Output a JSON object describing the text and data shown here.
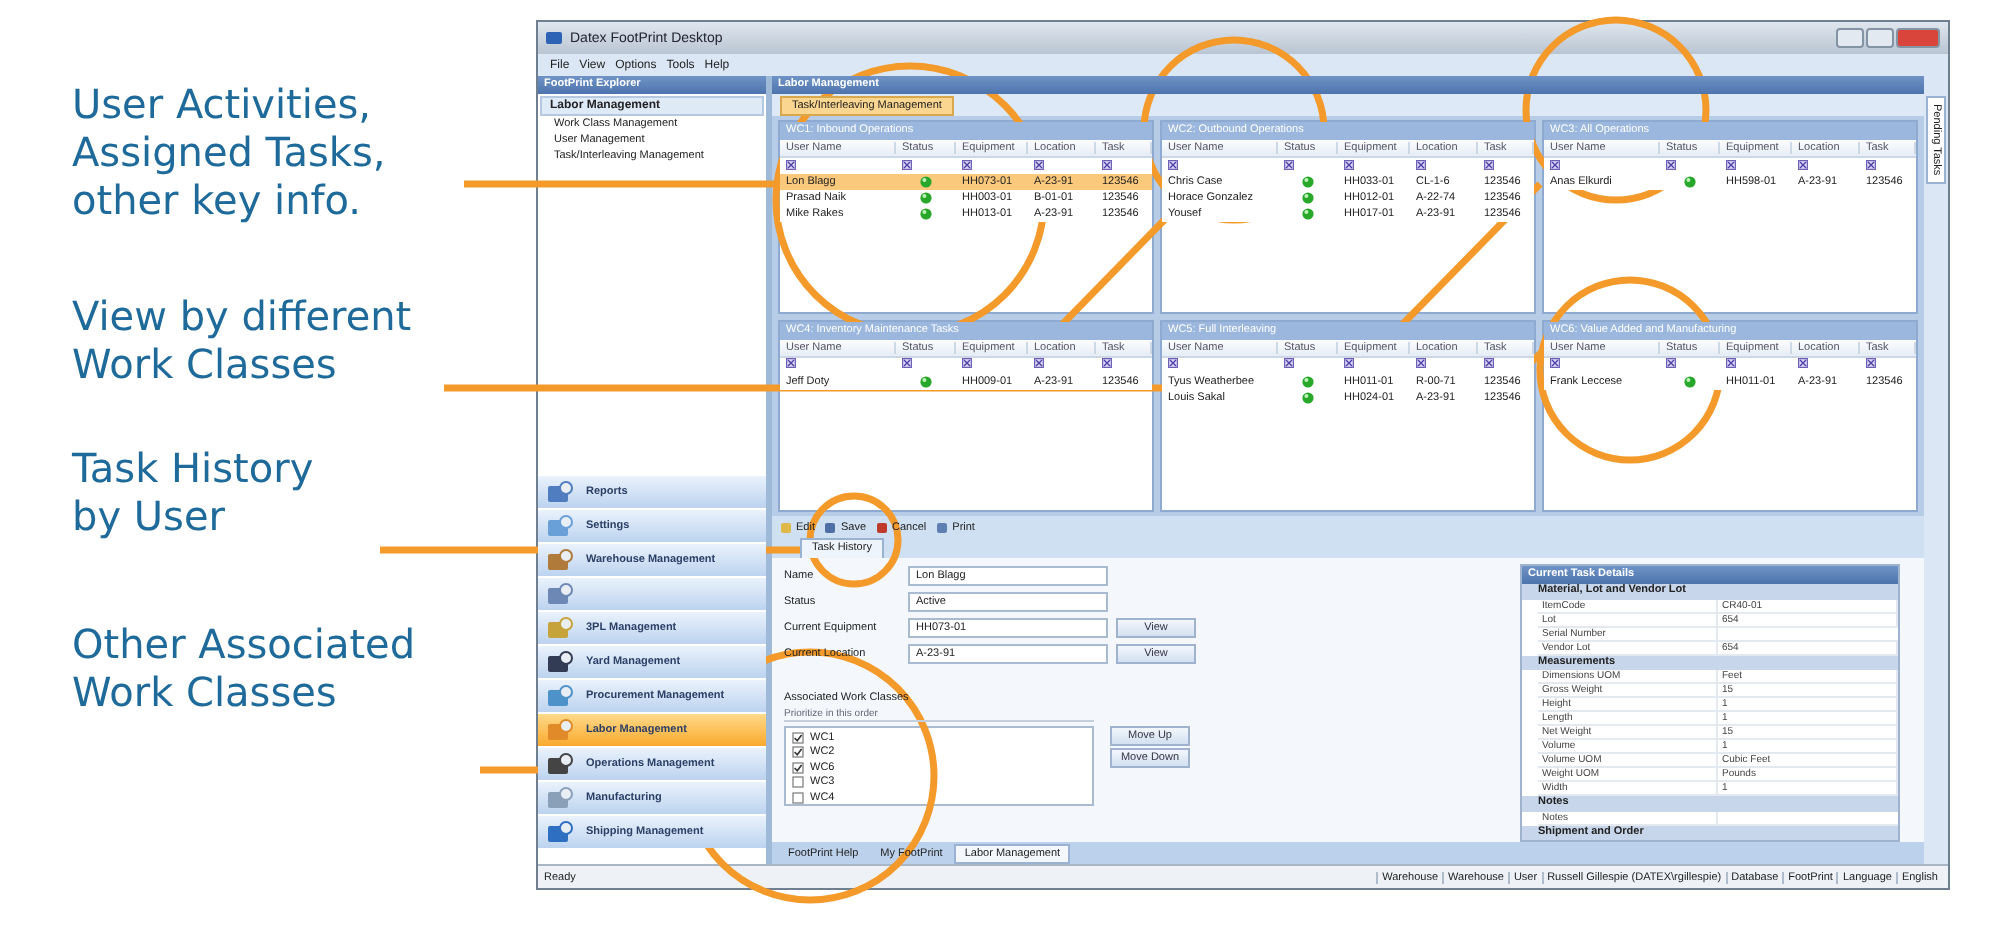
{
  "callouts": [
    {
      "lines": [
        "User Activities,",
        "Assigned Tasks,",
        "other key info."
      ]
    },
    {
      "lines": [
        "View by different",
        "Work Classes"
      ]
    },
    {
      "lines": [
        "Task History",
        "by User"
      ]
    },
    {
      "lines": [
        "Other Associated",
        "Work Classes"
      ]
    }
  ],
  "window": {
    "title": "Datex FootPrint Desktop",
    "menu": [
      "File",
      "View",
      "Options",
      "Tools",
      "Help"
    ]
  },
  "explorer": {
    "title": "FootPrint Explorer",
    "group": "Labor Management",
    "items": [
      "Work Class Management",
      "User Management",
      "Task/Interleaving Management"
    ],
    "nav": [
      {
        "label": "Reports",
        "selected": false
      },
      {
        "label": "Settings",
        "selected": false
      },
      {
        "label": "Warehouse Management",
        "selected": false
      },
      {
        "selected": false
      },
      {
        "label": "3PL Management",
        "selected": false
      },
      {
        "label": "Yard Management",
        "selected": false
      },
      {
        "label": "Procurement Management",
        "selected": false
      },
      {
        "label": "Labor Management",
        "selected": true
      },
      {
        "label": "Operations Management",
        "selected": false
      },
      {
        "label": "Manufacturing",
        "selected": false
      },
      {
        "label": "Shipping Management",
        "selected": false
      }
    ]
  },
  "main": {
    "title": "Labor Management",
    "doc_tab": "Task/Interleaving Management",
    "grids": [
      {
        "title": "WC1: Inbound Operations",
        "columns": [
          "User Name",
          "Status",
          "Equipment",
          "Location",
          "Task"
        ],
        "rows": [
          {
            "user": "Lon Blagg",
            "equipment": "HH073-01",
            "location": "A-23-91",
            "task": "123546",
            "selected": true
          },
          {
            "user": "Prasad Naik",
            "equipment": "HH003-01",
            "location": "B-01-01",
            "task": "123546",
            "selected": false
          },
          {
            "user": "Mike Rakes",
            "equipment": "HH013-01",
            "location": "A-23-91",
            "task": "123546",
            "selected": false
          }
        ]
      },
      {
        "title": "WC2: Outbound Operations",
        "columns": [
          "User Name",
          "Status",
          "Equipment",
          "Location",
          "Task"
        ],
        "rows": [
          {
            "user": "Chris Case",
            "equipment": "HH033-01",
            "location": "CL-1-6",
            "task": "123546",
            "selected": false
          },
          {
            "user": "Horace Gonzalez",
            "equipment": "HH012-01",
            "location": "A-22-74",
            "task": "123546",
            "selected": false
          },
          {
            "user": "Yousef",
            "equipment": "HH017-01",
            "location": "A-23-91",
            "task": "123546",
            "selected": false
          }
        ]
      },
      {
        "title": "WC3: All Operations",
        "columns": [
          "User Name",
          "Status",
          "Equipment",
          "Location",
          "Task"
        ],
        "rows": [
          {
            "user": "Anas Elkurdi",
            "equipment": "HH598-01",
            "location": "A-23-91",
            "task": "123546",
            "selected": false
          }
        ]
      },
      {
        "title": "WC4: Inventory Maintenance Tasks",
        "columns": [
          "User Name",
          "Status",
          "Equipment",
          "Location",
          "Task"
        ],
        "rows": [
          {
            "user": "Jeff Doty",
            "equipment": "HH009-01",
            "location": "A-23-91",
            "task": "123546",
            "selected": false
          }
        ]
      },
      {
        "title": "WC5: Full Interleaving",
        "columns": [
          "User Name",
          "Status",
          "Equipment",
          "Location",
          "Task"
        ],
        "rows": [
          {
            "user": "Tyus Weatherbee",
            "equipment": "HH011-01",
            "location": "R-00-71",
            "task": "123546",
            "selected": false
          },
          {
            "user": "Louis Sakal",
            "equipment": "HH024-01",
            "location": "A-23-91",
            "task": "123546",
            "selected": false
          }
        ]
      },
      {
        "title": "WC6: Value Added and Manufacturing",
        "columns": [
          "User Name",
          "Status",
          "Equipment",
          "Location",
          "Task"
        ],
        "rows": [
          {
            "user": "Frank Leccese",
            "equipment": "HH011-01",
            "location": "A-23-91",
            "task": "123546",
            "selected": false
          }
        ]
      }
    ],
    "toolbar": [
      "Edit",
      "Save",
      "Cancel",
      "Print"
    ],
    "detail_tab": "Task History",
    "form": {
      "fields": [
        {
          "label": "Name",
          "value": "Lon Blagg"
        },
        {
          "label": "Status",
          "value": "Active"
        },
        {
          "label": "Current Equipment",
          "value": "HH073-01",
          "button": "View"
        },
        {
          "label": "Current Location",
          "value": "A-23-91",
          "button": "View"
        }
      ],
      "heading": "Associated Work Classes",
      "subheading": "Prioritize in this order",
      "classes": [
        {
          "label": "WC1",
          "checked": true
        },
        {
          "label": "WC2",
          "checked": true
        },
        {
          "label": "WC6",
          "checked": true
        },
        {
          "label": "WC3",
          "checked": false
        },
        {
          "label": "WC4",
          "checked": false
        }
      ],
      "buttons": [
        "Move Up",
        "Move Down"
      ]
    },
    "properties": {
      "title": "Current Task Details",
      "sections": [
        {
          "name": "Material, Lot and Vendor Lot",
          "rows": [
            {
              "name": "ItemCode",
              "value": "CR40-01"
            },
            {
              "name": "Lot",
              "value": "654"
            },
            {
              "name": "Serial Number"
            },
            {
              "name": "Vendor Lot",
              "value": "654"
            }
          ]
        },
        {
          "name": "Measurements",
          "rows": [
            {
              "name": "Dimensions UOM",
              "value": "Feet"
            },
            {
              "name": "Gross Weight",
              "value": "15"
            },
            {
              "name": "Height",
              "value": "1"
            },
            {
              "name": "Length",
              "value": "1"
            },
            {
              "name": "Net Weight",
              "value": "15"
            },
            {
              "name": "Volume",
              "value": "1"
            },
            {
              "name": "Volume UOM",
              "value": "Cubic Feet"
            },
            {
              "name": "Weight UOM",
              "value": "Pounds"
            },
            {
              "name": "Width",
              "value": "1"
            }
          ]
        },
        {
          "name": "Notes",
          "rows": [
            {
              "name": "Notes"
            }
          ]
        },
        {
          "name": "Shipment and Order"
        }
      ]
    },
    "bottom_tabs": [
      {
        "label": "FootPrint Help",
        "selected": false
      },
      {
        "label": "My FootPrint",
        "selected": false
      },
      {
        "label": "Labor Management",
        "selected": true
      }
    ]
  },
  "side_tab": "Pending Tasks",
  "status_bar": {
    "text": "Ready",
    "fields": [
      "Warehouse",
      "Warehouse",
      "User",
      "Russell Gillespie (DATEX\\rgillespie)",
      "Database",
      "FootPrint",
      "Language",
      "English"
    ]
  }
}
